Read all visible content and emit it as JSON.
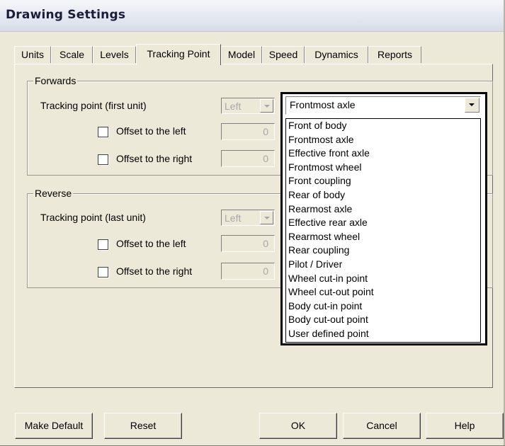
{
  "window": {
    "title": "Drawing Settings"
  },
  "tabs": [
    {
      "label": "Units"
    },
    {
      "label": "Scale"
    },
    {
      "label": "Levels"
    },
    {
      "label": "Tracking Point",
      "active": true
    },
    {
      "label": "Model"
    },
    {
      "label": "Speed"
    },
    {
      "label": "Dynamics"
    },
    {
      "label": "Reports"
    }
  ],
  "forwards": {
    "group_label": "Forwards",
    "tracking_label": "Tracking point (first unit)",
    "side_value": "Left",
    "offset_left_label": "Offset to the left",
    "offset_left_value": "0",
    "offset_right_label": "Offset to the right",
    "offset_right_value": "0"
  },
  "reverse": {
    "group_label": "Reverse",
    "tracking_label": "Tracking point (last unit)",
    "side_value": "Left",
    "offset_left_label": "Offset to the left",
    "offset_left_value": "0",
    "offset_right_label": "Offset to the right",
    "offset_right_value": "0"
  },
  "dropdown": {
    "selected": "Frontmost axle",
    "options": [
      "Front of body",
      "Frontmost axle",
      "Effective front axle",
      "Frontmost wheel",
      "Front coupling",
      "Rear of body",
      "Rearmost axle",
      "Effective rear axle",
      "Rearmost wheel",
      "Rear coupling",
      "Pilot / Driver",
      "Wheel cut-in point",
      "Wheel cut-out point",
      "Body cut-in point",
      "Body cut-out point",
      "User defined point"
    ]
  },
  "buttons": {
    "make_default": "Make Default",
    "reset": "Reset",
    "ok": "OK",
    "cancel": "Cancel",
    "help": "Help"
  }
}
